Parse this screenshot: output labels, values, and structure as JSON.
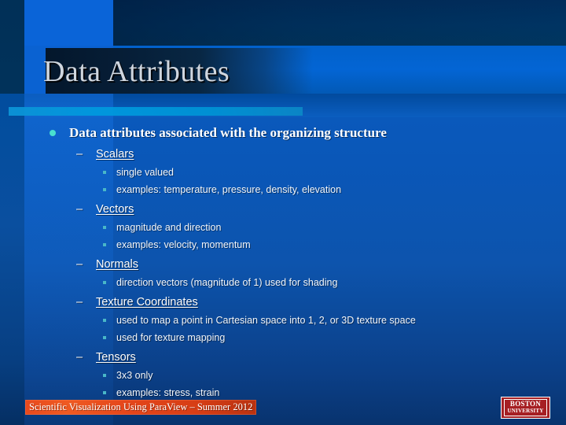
{
  "slide": {
    "title": "Data Attributes",
    "theme": {
      "background_blue": "#0a5ec4",
      "header_navy": "#01335f",
      "accent_cyan": "#0099de",
      "bullet_teal": "#49e0cf",
      "sub_bullet_teal": "#49b7c8",
      "footer_orange": "#e8491d",
      "logo_crimson": "#a61f23",
      "title_text": "#cfd6df"
    },
    "content": {
      "level1": {
        "text": "Data attributes associated with the organizing structure",
        "bullet": "disc-bullet"
      },
      "groups": [
        {
          "heading": "Scalars",
          "dash": "–",
          "items": [
            "single valued",
            "examples: temperature, pressure, density, elevation"
          ]
        },
        {
          "heading": "Vectors",
          "dash": "–",
          "items": [
            "magnitude and direction",
            "examples: velocity, momentum"
          ]
        },
        {
          "heading": "Normals",
          "dash": "–",
          "items": [
            "direction vectors (magnitude of 1) used for shading"
          ]
        },
        {
          "heading": "Texture Coordinates",
          "dash": "–",
          "items": [
            "used to map a point in Cartesian space into 1, 2, or 3D texture space",
            "used for texture mapping"
          ]
        },
        {
          "heading": "Tensors",
          "dash": "–",
          "items": [
            "3x3 only",
            "examples: stress, strain"
          ]
        }
      ]
    },
    "footer": {
      "banner_text": "Scientific Visualization Using ParaView – Summer 2012",
      "logo": {
        "line1": "BOSTON",
        "line2": "UNIVERSITY"
      }
    }
  }
}
